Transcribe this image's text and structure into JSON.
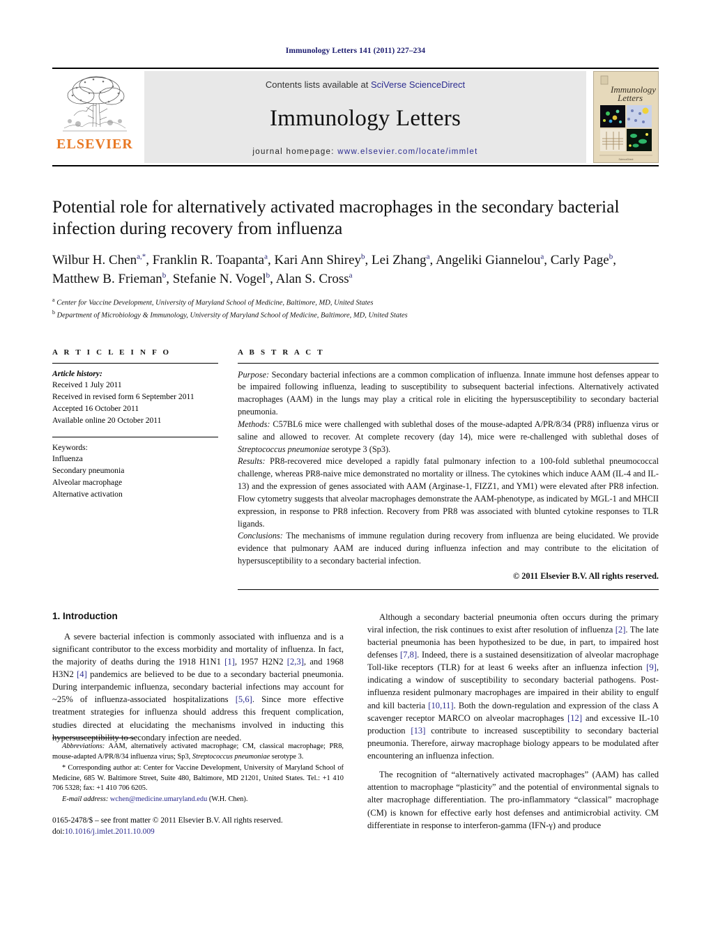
{
  "running_head": "Immunology Letters 141 (2011) 227–234",
  "masthead": {
    "publisher_name": "ELSEVIER",
    "contents_prefix": "Contents lists available at ",
    "contents_link": "SciVerse ScienceDirect",
    "journal_title": "Immunology Letters",
    "homepage_label": "journal homepage:",
    "homepage_url": "www.elsevier.com/locate/immlet",
    "cover_title_line1": "Immunology",
    "cover_title_line2": "Letters",
    "accent_orange": "#E87722",
    "link_blue": "#2b2b8f",
    "masthead_grey": "#e8e8e8",
    "cover_bg": "#e6d9bb"
  },
  "article": {
    "title": "Potential role for alternatively activated macrophages in the secondary bacterial infection during recovery from influenza",
    "authors_line1": "Wilbur H. Chen",
    "authors_html": "Wilbur H. Chen<sup>a,*</sup>, Franklin R. Toapanta<sup>a</sup>, Kari Ann Shirey<sup>b</sup>, Lei Zhang<sup>a</sup>, Angeliki Giannelou<sup>a</sup>, Carly Page<sup>b</sup>, Matthew B. Frieman<sup>b</sup>, Stefanie N. Vogel<sup>b</sup>, Alan S. Cross<sup>a</sup>",
    "affiliation_a": "Center for Vaccine Development, University of Maryland School of Medicine, Baltimore, MD, United States",
    "affiliation_b": "Department of Microbiology & Immunology, University of Maryland School of Medicine, Baltimore, MD, United States"
  },
  "article_info": {
    "heading": "A R T I C L E   I N F O",
    "history_label": "Article history:",
    "history": [
      "Received 1 July 2011",
      "Received in revised form 6 September 2011",
      "Accepted 16 October 2011",
      "Available online 20 October 2011"
    ],
    "keywords_label": "Keywords:",
    "keywords": [
      "Influenza",
      "Secondary pneumonia",
      "Alveolar macrophage",
      "Alternative activation"
    ]
  },
  "abstract": {
    "heading": "A B S T R A C T",
    "purpose_label": "Purpose:",
    "purpose_text": " Secondary bacterial infections are a common complication of influenza. Innate immune host defenses appear to be impaired following influenza, leading to susceptibility to subsequent bacterial infections. Alternatively activated macrophages (AAM) in the lungs may play a critical role in eliciting the hypersusceptibility to secondary bacterial pneumonia.",
    "methods_label": "Methods:",
    "methods_text_a": " C57BL6 mice were challenged with sublethal doses of the mouse-adapted A/PR/8/34 (PR8) influenza virus or saline and allowed to recover. At complete recovery (day 14), mice were re-challenged with sublethal doses of ",
    "methods_italic": "Streptococcus pneumoniae",
    "methods_text_b": " serotype 3 (Sp3).",
    "results_label": "Results:",
    "results_text": " PR8-recovered mice developed a rapidly fatal pulmonary infection to a 100-fold sublethal pneumococcal challenge, whereas PR8-naive mice demonstrated no mortality or illness. The cytokines which induce AAM (IL-4 and IL-13) and the expression of genes associated with AAM (Arginase-1, FIZZ1, and YM1) were elevated after PR8 infection. Flow cytometry suggests that alveolar macrophages demonstrate the AAM-phenotype, as indicated by MGL-1 and MHCII expression, in response to PR8 infection. Recovery from PR8 was associated with blunted cytokine responses to TLR ligands.",
    "conclusions_label": "Conclusions:",
    "conclusions_text": " The mechanisms of immune regulation during recovery from influenza are being elucidated. We provide evidence that pulmonary AAM are induced during influenza infection and may contribute to the elicitation of hypersusceptibility to a secondary bacterial infection.",
    "copyright": "© 2011 Elsevier B.V. All rights reserved."
  },
  "body": {
    "section_heading": "1. Introduction",
    "left_para1_parts": [
      "A severe bacterial infection is commonly associated with influenza and is a significant contributor to the excess morbidity and mortality of influenza. In fact, the majority of deaths during the 1918 H1N1 ",
      "[1]",
      ", 1957 H2N2 ",
      "[2,3]",
      ", and 1968 H3N2 ",
      "[4]",
      " pandemics are believed to be due to a secondary bacterial pneumonia. During interpandemic influenza, secondary bacterial infections may account for ~25% of influenza-associated hospitalizations ",
      "[5,6]",
      ". Since more effective treatment strategies for influenza should address this frequent complication, studies directed at elucidating the mechanisms involved in inducting this hypersusceptibility to secondary infection are needed."
    ],
    "right_para1_parts": [
      "Although a secondary bacterial pneumonia often occurs during the primary viral infection, the risk continues to exist after resolution of influenza ",
      "[2]",
      ". The late bacterial pneumonia has been hypothesized to be due, in part, to impaired host defenses ",
      "[7,8]",
      ". Indeed, there is a sustained desensitization of alveolar macrophage Toll-like receptors (TLR) for at least 6 weeks after an influenza infection ",
      "[9]",
      ", indicating a window of susceptibility to secondary bacterial pathogens. Post-influenza resident pulmonary macrophages are impaired in their ability to engulf and kill bacteria ",
      "[10,11]",
      ". Both the down-regulation and expression of the class A scavenger receptor MARCO on alveolar macrophages ",
      "[12]",
      " and excessive IL-10 production ",
      "[13]",
      " contribute to increased susceptibility to secondary bacterial pneumonia. Therefore, airway macrophage biology appears to be modulated after encountering an influenza infection."
    ],
    "right_para2": "The recognition of “alternatively activated macrophages” (AAM) has called attention to macrophage “plasticity” and the potential of environmental signals to alter macrophage differentiation. The pro-inflammatory “classical” macrophage (CM) is known for effective early host defenses and antimicrobial activity. CM differentiate in response to interferon-gamma (IFN-γ) and produce"
  },
  "footnotes": {
    "abbrev_label": "Abbreviations:",
    "abbrev_text_a": " AAM, alternatively activated macrophage; CM, classical macrophage; PR8, mouse-adapted A/PR/8/34 influenza virus; Sp3, ",
    "abbrev_italic": "Streptococcus pneumoniae",
    "abbrev_text_b": " serotype 3.",
    "corresponding": "* Corresponding author at: Center for Vaccine Development, University of Maryland School of Medicine, 685 W. Baltimore Street, Suite 480, Baltimore, MD 21201, United States. Tel.: +1 410 706 5328; fax: +1 410 706 6205.",
    "email_label": "E-mail address:",
    "email_address": "wchen@medicine.umaryland.edu",
    "email_suffix": " (W.H. Chen).",
    "issn_line": "0165-2478/$ – see front matter © 2011 Elsevier B.V. All rights reserved.",
    "doi_label": "doi:",
    "doi_value": "10.1016/j.imlet.2011.10.009"
  }
}
